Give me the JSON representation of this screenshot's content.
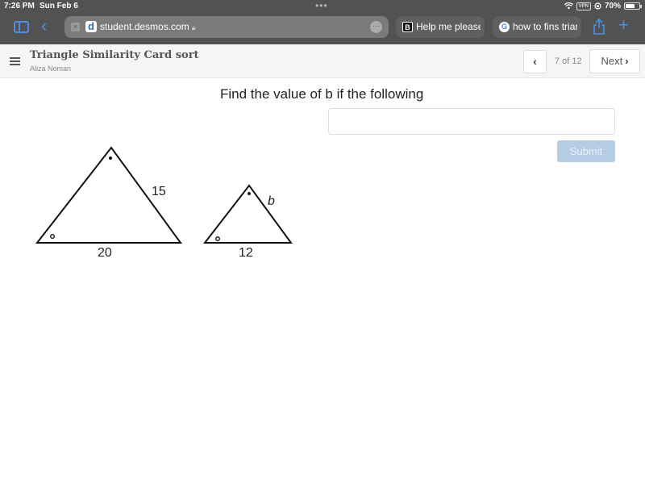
{
  "status_bar": {
    "time": "7:26 PM",
    "date": "Sun Feb 6",
    "vpn": "VPN",
    "battery": "70%",
    "battery_level": 0.7
  },
  "browser": {
    "url": "student.desmos.com",
    "tabs": [
      {
        "label": "Help me please",
        "icon": "B"
      },
      {
        "label": "how to fins triar",
        "icon": "G"
      }
    ],
    "icons": {
      "sidebar": "sidebar-icon",
      "back": "‹",
      "close": "×",
      "favicon": "d",
      "lock": "🔒",
      "more": "···",
      "share": "share-icon",
      "new_tab": "+"
    }
  },
  "header": {
    "title": "Triangle Similarity Card sort",
    "student": "Aliza Noman",
    "page_counter": "7 of 12",
    "prev_icon": "‹",
    "next_label": "Next",
    "next_icon": "›"
  },
  "question": {
    "prompt": "Find the value of b if the following",
    "answer_value": "",
    "submit_label": "Submit"
  },
  "figure": {
    "large_triangle": {
      "side_label": "15",
      "base_label": "20"
    },
    "small_triangle": {
      "side_label": "b",
      "base_label": "12"
    }
  }
}
